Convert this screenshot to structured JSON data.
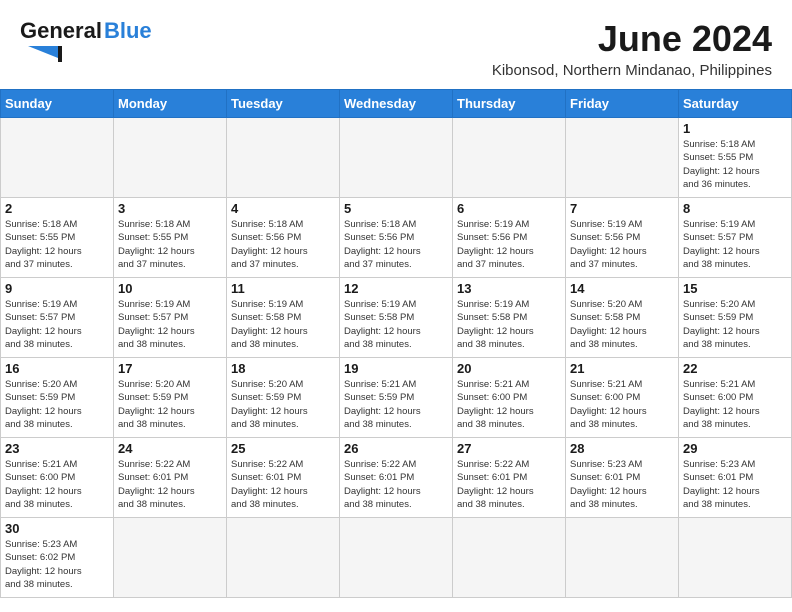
{
  "header": {
    "logo_general": "General",
    "logo_blue": "Blue",
    "month_year": "June 2024",
    "location": "Kibonsod, Northern Mindanao, Philippines"
  },
  "weekdays": [
    "Sunday",
    "Monday",
    "Tuesday",
    "Wednesday",
    "Thursday",
    "Friday",
    "Saturday"
  ],
  "weeks": [
    [
      {
        "day": "",
        "info": "",
        "empty": true
      },
      {
        "day": "",
        "info": "",
        "empty": true
      },
      {
        "day": "",
        "info": "",
        "empty": true
      },
      {
        "day": "",
        "info": "",
        "empty": true
      },
      {
        "day": "",
        "info": "",
        "empty": true
      },
      {
        "day": "",
        "info": "",
        "empty": true
      },
      {
        "day": "1",
        "info": "Sunrise: 5:18 AM\nSunset: 5:55 PM\nDaylight: 12 hours\nand 36 minutes."
      }
    ],
    [
      {
        "day": "2",
        "info": "Sunrise: 5:18 AM\nSunset: 5:55 PM\nDaylight: 12 hours\nand 37 minutes."
      },
      {
        "day": "3",
        "info": "Sunrise: 5:18 AM\nSunset: 5:55 PM\nDaylight: 12 hours\nand 37 minutes."
      },
      {
        "day": "4",
        "info": "Sunrise: 5:18 AM\nSunset: 5:56 PM\nDaylight: 12 hours\nand 37 minutes."
      },
      {
        "day": "5",
        "info": "Sunrise: 5:18 AM\nSunset: 5:56 PM\nDaylight: 12 hours\nand 37 minutes."
      },
      {
        "day": "6",
        "info": "Sunrise: 5:19 AM\nSunset: 5:56 PM\nDaylight: 12 hours\nand 37 minutes."
      },
      {
        "day": "7",
        "info": "Sunrise: 5:19 AM\nSunset: 5:56 PM\nDaylight: 12 hours\nand 37 minutes."
      },
      {
        "day": "8",
        "info": "Sunrise: 5:19 AM\nSunset: 5:57 PM\nDaylight: 12 hours\nand 38 minutes."
      }
    ],
    [
      {
        "day": "9",
        "info": "Sunrise: 5:19 AM\nSunset: 5:57 PM\nDaylight: 12 hours\nand 38 minutes."
      },
      {
        "day": "10",
        "info": "Sunrise: 5:19 AM\nSunset: 5:57 PM\nDaylight: 12 hours\nand 38 minutes."
      },
      {
        "day": "11",
        "info": "Sunrise: 5:19 AM\nSunset: 5:58 PM\nDaylight: 12 hours\nand 38 minutes."
      },
      {
        "day": "12",
        "info": "Sunrise: 5:19 AM\nSunset: 5:58 PM\nDaylight: 12 hours\nand 38 minutes."
      },
      {
        "day": "13",
        "info": "Sunrise: 5:19 AM\nSunset: 5:58 PM\nDaylight: 12 hours\nand 38 minutes."
      },
      {
        "day": "14",
        "info": "Sunrise: 5:20 AM\nSunset: 5:58 PM\nDaylight: 12 hours\nand 38 minutes."
      },
      {
        "day": "15",
        "info": "Sunrise: 5:20 AM\nSunset: 5:59 PM\nDaylight: 12 hours\nand 38 minutes."
      }
    ],
    [
      {
        "day": "16",
        "info": "Sunrise: 5:20 AM\nSunset: 5:59 PM\nDaylight: 12 hours\nand 38 minutes."
      },
      {
        "day": "17",
        "info": "Sunrise: 5:20 AM\nSunset: 5:59 PM\nDaylight: 12 hours\nand 38 minutes."
      },
      {
        "day": "18",
        "info": "Sunrise: 5:20 AM\nSunset: 5:59 PM\nDaylight: 12 hours\nand 38 minutes."
      },
      {
        "day": "19",
        "info": "Sunrise: 5:21 AM\nSunset: 5:59 PM\nDaylight: 12 hours\nand 38 minutes."
      },
      {
        "day": "20",
        "info": "Sunrise: 5:21 AM\nSunset: 6:00 PM\nDaylight: 12 hours\nand 38 minutes."
      },
      {
        "day": "21",
        "info": "Sunrise: 5:21 AM\nSunset: 6:00 PM\nDaylight: 12 hours\nand 38 minutes."
      },
      {
        "day": "22",
        "info": "Sunrise: 5:21 AM\nSunset: 6:00 PM\nDaylight: 12 hours\nand 38 minutes."
      }
    ],
    [
      {
        "day": "23",
        "info": "Sunrise: 5:21 AM\nSunset: 6:00 PM\nDaylight: 12 hours\nand 38 minutes."
      },
      {
        "day": "24",
        "info": "Sunrise: 5:22 AM\nSunset: 6:01 PM\nDaylight: 12 hours\nand 38 minutes."
      },
      {
        "day": "25",
        "info": "Sunrise: 5:22 AM\nSunset: 6:01 PM\nDaylight: 12 hours\nand 38 minutes."
      },
      {
        "day": "26",
        "info": "Sunrise: 5:22 AM\nSunset: 6:01 PM\nDaylight: 12 hours\nand 38 minutes."
      },
      {
        "day": "27",
        "info": "Sunrise: 5:22 AM\nSunset: 6:01 PM\nDaylight: 12 hours\nand 38 minutes."
      },
      {
        "day": "28",
        "info": "Sunrise: 5:23 AM\nSunset: 6:01 PM\nDaylight: 12 hours\nand 38 minutes."
      },
      {
        "day": "29",
        "info": "Sunrise: 5:23 AM\nSunset: 6:01 PM\nDaylight: 12 hours\nand 38 minutes."
      }
    ],
    [
      {
        "day": "30",
        "info": "Sunrise: 5:23 AM\nSunset: 6:02 PM\nDaylight: 12 hours\nand 38 minutes."
      },
      {
        "day": "",
        "info": "",
        "empty": true
      },
      {
        "day": "",
        "info": "",
        "empty": true
      },
      {
        "day": "",
        "info": "",
        "empty": true
      },
      {
        "day": "",
        "info": "",
        "empty": true
      },
      {
        "day": "",
        "info": "",
        "empty": true
      },
      {
        "day": "",
        "info": "",
        "empty": true
      }
    ]
  ]
}
